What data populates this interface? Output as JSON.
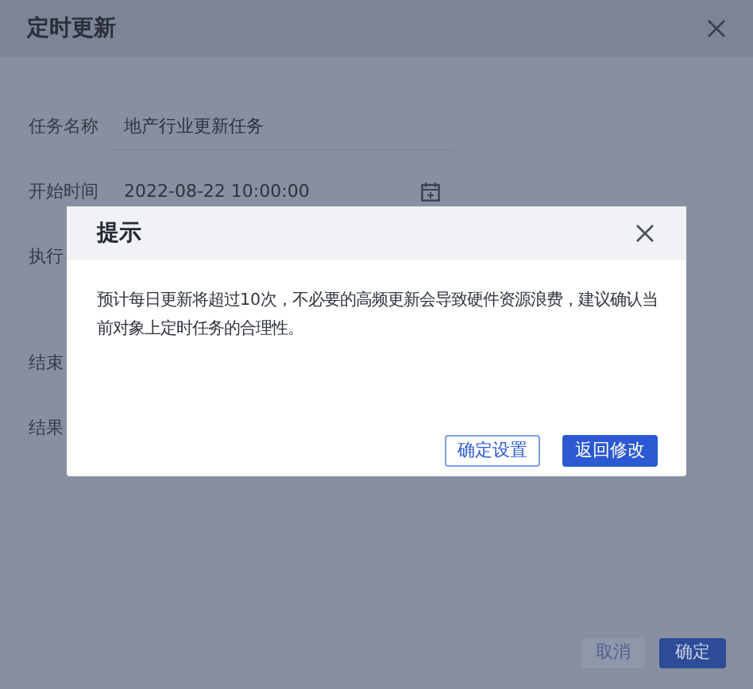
{
  "dialog": {
    "title": "定时更新",
    "fields": [
      {
        "label": "任务名称",
        "value": "地产行业更新任务",
        "kind": "text"
      },
      {
        "label": "开始时间",
        "value": "2022-08-22 10:00:00",
        "kind": "date"
      },
      {
        "label": "执行",
        "kind": "hidden"
      },
      {
        "label": "结束",
        "kind": "hidden"
      },
      {
        "label": "结果",
        "kind": "hidden"
      }
    ],
    "buttons": [
      {
        "label": "取消",
        "kind": "secondary"
      },
      {
        "label": "确定",
        "kind": "primary"
      }
    ]
  },
  "prompt": {
    "title": "提示",
    "message": "预计每日更新将超过10次，不必要的高频更新会导致硬件资源浪费，建议确认当前对象上定时任务的合理性。",
    "buttons": [
      {
        "label": "确定设置",
        "kind": "secondary"
      },
      {
        "label": "返回修改",
        "kind": "primary"
      }
    ]
  }
}
